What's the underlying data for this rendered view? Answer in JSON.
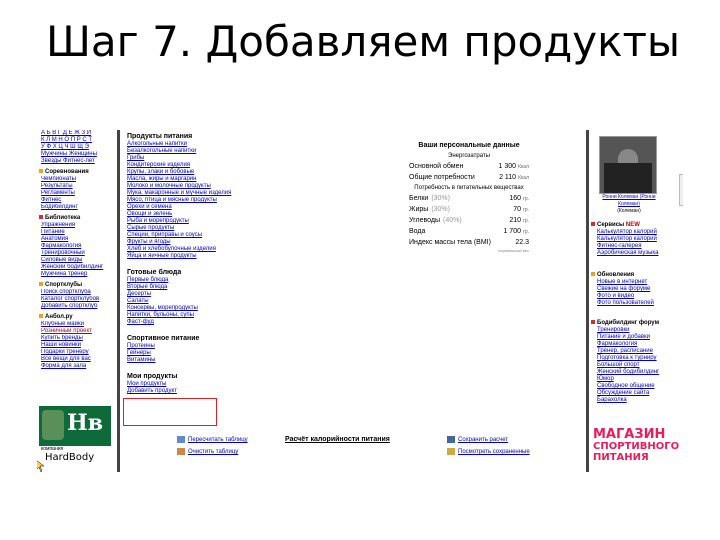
{
  "slide": {
    "title": "Шаг 7. Добавляем продукты"
  },
  "left": {
    "alphabet_1": "А Б В Г Д Е Ж З И",
    "alphabet_2": "К Л М Н О П Р С Т",
    "alphabet_3": "У Ф Х Ц Ч Ш Щ Э",
    "top_links": [
      "Мужчины Женщины",
      "Звезды Фитнес-лет"
    ],
    "sections": [
      {
        "title": "Соревнования",
        "color": "#f0a020",
        "items": [
          "Чемпионаты",
          "Результаты",
          "Регламенты",
          "Фитнес",
          "Бодибилдинг"
        ]
      },
      {
        "title": "Библиотека",
        "color": "#d03030",
        "items": [
          "Упражнения",
          "Питание",
          "Анатомия",
          "Фармакология",
          "Тренировочный",
          "Силовые виды",
          "Женский бодибилдинг",
          "Мужчина тренер"
        ]
      },
      {
        "title": "Спортклубы",
        "color": "#f0a020",
        "items": [
          "Поиск спортклуба",
          "Каталог спортклубов",
          "Добавить спортклуб"
        ]
      },
      {
        "title": "Анбол.ру",
        "color": "#f0a020",
        "items": [
          "Клубные майки",
          "Розничный проект",
          "Купить бренды",
          "Наши новинки",
          "Подарки тренеру",
          "Все вещи для вас",
          "Форма для зала"
        ]
      }
    ],
    "logo_mark": "Hв",
    "logo_caption": "компания",
    "logo_name": "HardBody"
  },
  "middle": {
    "food_title": "Продукты питания",
    "food_items": [
      "Алкогольные напитки",
      "Безалкогольные напитки",
      "Грибы",
      "Кондитерские изделия",
      "Крупы, злаки и бобовые",
      "Масла, жиры и маргарин",
      "Молоко и молочные продукты",
      "Мука, макаронные и мучные изделия",
      "Мясо, птица и мясные продукты",
      "Орехи и семена",
      "Овощи и зелень",
      "Рыба и морепродукты",
      "Сырые продукты",
      "Специи, приправы и соусы",
      "Фрукты и ягоды",
      "Хлеб и хлебобулочные изделия",
      "Яйца и яичные продукты"
    ],
    "ready_title": "Готовые блюда",
    "ready_items": [
      "Первые блюда",
      "Вторые блюда",
      "Десерты",
      "Салаты",
      "Консервы, морепродукты",
      "Напитки, бульоны, супы",
      "Фаст-фуд"
    ],
    "sport_title": "Спортивное питание",
    "sport_items": [
      "Протеины",
      "Гейнеры",
      "Витамины"
    ],
    "my_title": "Мои продукты",
    "my_items": [
      "Мои продукты",
      "Добавить продукт"
    ]
  },
  "personal": {
    "title": "Ваши персональные данные",
    "energy_label": "Энергозатраты",
    "metabolism": {
      "label": "Основной обмен",
      "value": "1 300",
      "unit": "Ккал"
    },
    "total": {
      "label": "Общие потребности",
      "value": "2 110",
      "unit": "Ккал"
    },
    "nutrients_label": "Потребность в питательных веществах",
    "protein": {
      "label": "Белки",
      "pct": "(30%)",
      "value": "160",
      "unit": "гр."
    },
    "fat": {
      "label": "Жиры",
      "pct": "(30%)",
      "value": "70",
      "unit": "гр."
    },
    "carbs": {
      "label": "Углеводы",
      "pct": "(40%)",
      "value": "210",
      "unit": "гр."
    },
    "water": {
      "label": "Вода",
      "value": "1 700",
      "unit": "гр."
    },
    "bmi": {
      "label": "Индекс массы тела (BMI)",
      "value": "22.3",
      "note": "нормальный вес"
    }
  },
  "bottom": {
    "recalc": "Пересчитать таблицу",
    "clear": "Очистить таблицу",
    "calc": "Расчёт калорийности питания",
    "save": "Сохранить расчет",
    "view": "Посмотреть сохраненные"
  },
  "right": {
    "photo_caption": "Ронни Колеман (Ронни Колеман)",
    "photo_sub": "(Колеман)",
    "services_title": "Сервисы",
    "new_badge": "NEW",
    "services": [
      "Калькулятор калорий",
      "Калькулятор калорий",
      "Фитнес-галерея",
      "Аэробическая музыка"
    ],
    "updates_title": "Обновления",
    "updates": [
      "Новые в интернет",
      "Свежие на форуме",
      "Фото и видео",
      "Фото пользователей"
    ],
    "forum_title": "Бодибилдинг форум",
    "forum": [
      "Тренировки",
      "Питание и добавки",
      "Фармакология",
      "Тренер, расписание",
      "Подготовка к турниру",
      "Большой спорт",
      "Женский бодибилдинг",
      "Юмор",
      "Свободное общение",
      "Обсуждение сайта",
      "Барахолка"
    ],
    "shop_line1": "МАГАЗИН",
    "shop_line2": "СПОРТИВНОГО",
    "shop_line3": "ПИТАНИЯ"
  },
  "colors": {
    "link": "#0000cc",
    "highlight_box": "#dd2222",
    "shop": "#ee1a5e",
    "logo": "#0f6a3a"
  }
}
